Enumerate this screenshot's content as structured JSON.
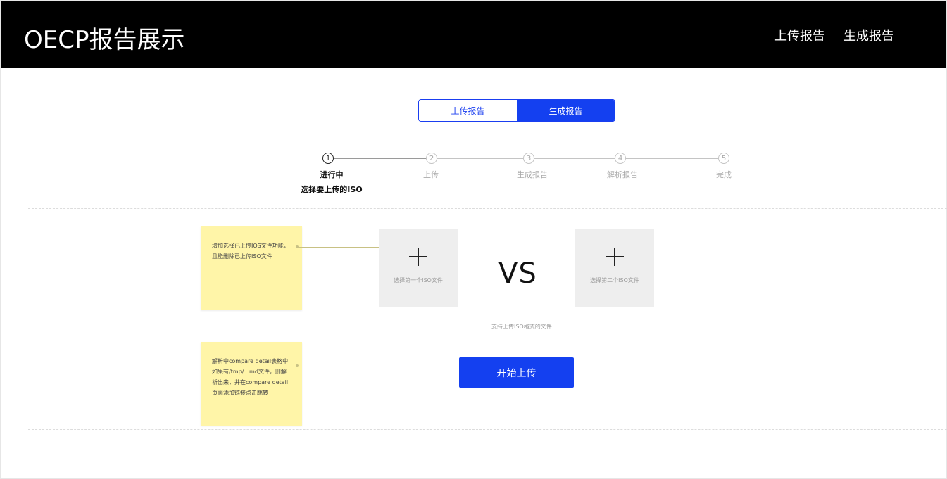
{
  "header": {
    "title": "OECP报告展示",
    "nav": [
      "上传报告",
      "生成报告"
    ]
  },
  "tabs": [
    {
      "label": "上传报告",
      "active": false
    },
    {
      "label": "生成报告",
      "active": true
    }
  ],
  "steps": [
    {
      "number": "1",
      "label": "进行中",
      "sub": "选择要上传的ISO",
      "status": "current"
    },
    {
      "number": "2",
      "label": "上传",
      "status": "pending"
    },
    {
      "number": "3",
      "label": "生成报告",
      "status": "pending"
    },
    {
      "number": "4",
      "label": "解析报告",
      "status": "pending"
    },
    {
      "number": "5",
      "label": "完成",
      "status": "pending"
    }
  ],
  "notes": [
    "增加选择已上传IOS文件功能，且能删除已上传ISO文件",
    "解析中compare detail表格中如果有/tmp/...md文件，则解析出来，并在compare detail页面添加链接点击跳转"
  ],
  "upload": {
    "first_label": "选择第一个ISO文件",
    "second_label": "选择第二个ISO文件",
    "vs": "VS",
    "hint": "支持上传ISO格式的文件",
    "start_button": "开始上传"
  },
  "colors": {
    "accent": "#1440f0",
    "header_bg": "#000000",
    "note_bg": "#fff5a8"
  }
}
